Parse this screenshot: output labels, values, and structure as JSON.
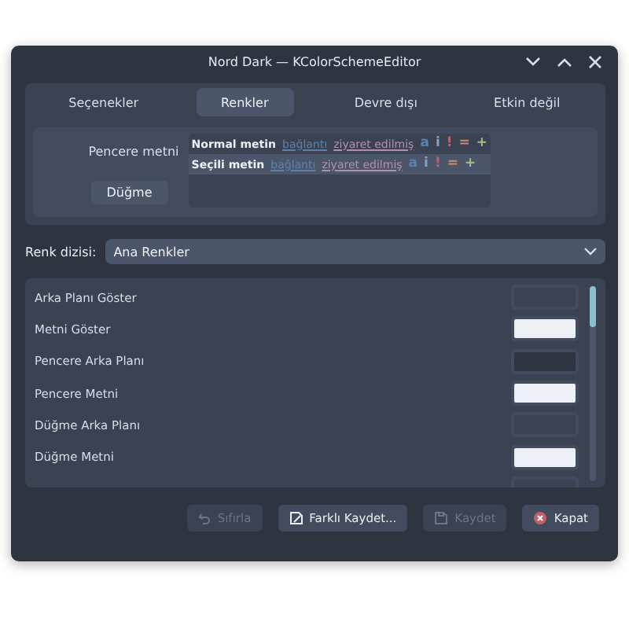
{
  "window": {
    "title": "Nord Dark — KColorSchemeEditor"
  },
  "tabs": [
    {
      "label": "Seçenekler",
      "selected": false
    },
    {
      "label": "Renkler",
      "selected": true
    },
    {
      "label": "Devre dışı",
      "selected": false
    },
    {
      "label": "Etkin değil",
      "selected": false
    }
  ],
  "preview": {
    "label": "Pencere metni",
    "button": "Düğme",
    "lines": [
      {
        "selected": false,
        "parts": [
          {
            "text": "Normal metin",
            "kind": "plain",
            "color": "#eceff4"
          },
          {
            "text": "bağlantı",
            "kind": "link",
            "color": "#5e81ac"
          },
          {
            "text": "ziyaret edilmiş",
            "kind": "link",
            "color": "#b48ead"
          },
          {
            "text": "a",
            "kind": "mark",
            "color": "#5e81ac"
          },
          {
            "text": "i",
            "kind": "mark",
            "color": "#81a1c1"
          },
          {
            "text": "!",
            "kind": "mark",
            "color": "#bf616a"
          },
          {
            "text": "=",
            "kind": "mark",
            "color": "#d08770"
          },
          {
            "text": "+",
            "kind": "mark",
            "color": "#a3be8c"
          }
        ]
      },
      {
        "selected": true,
        "parts": [
          {
            "text": "Seçili metin",
            "kind": "plain",
            "color": "#eceff4"
          },
          {
            "text": "bağlantı",
            "kind": "link",
            "color": "#5e81ac"
          },
          {
            "text": "ziyaret edilmiş",
            "kind": "link",
            "color": "#b48ead"
          },
          {
            "text": "a",
            "kind": "mark",
            "color": "#5e81ac"
          },
          {
            "text": "i",
            "kind": "mark",
            "color": "#81a1c1"
          },
          {
            "text": "!",
            "kind": "mark",
            "color": "#bf616a"
          },
          {
            "text": "=",
            "kind": "mark",
            "color": "#d08770"
          },
          {
            "text": "+",
            "kind": "mark",
            "color": "#a3be8c"
          }
        ]
      }
    ]
  },
  "color_set": {
    "label": "Renk dizisi:",
    "value": "Ana Renkler"
  },
  "colors": [
    {
      "name": "Arka Planı Göster",
      "color": "#3b4252"
    },
    {
      "name": "Metni Göster",
      "color": "#eceff4"
    },
    {
      "name": "Pencere Arka Planı",
      "color": "#2e3440"
    },
    {
      "name": "Pencere Metni",
      "color": "#eceff4"
    },
    {
      "name": "Düğme Arka Planı",
      "color": "#3b4252"
    },
    {
      "name": "Düğme Metni",
      "color": "#eceff4"
    },
    {
      "color": "#3b4252"
    }
  ],
  "buttons": [
    {
      "label": "Sıfırla",
      "kind": "reset",
      "disabled": true
    },
    {
      "label": "Farklı Kaydet...",
      "kind": "saveas",
      "disabled": false
    },
    {
      "label": "Kaydet",
      "kind": "save",
      "disabled": true
    },
    {
      "label": "Kapat",
      "kind": "close",
      "disabled": false
    }
  ]
}
